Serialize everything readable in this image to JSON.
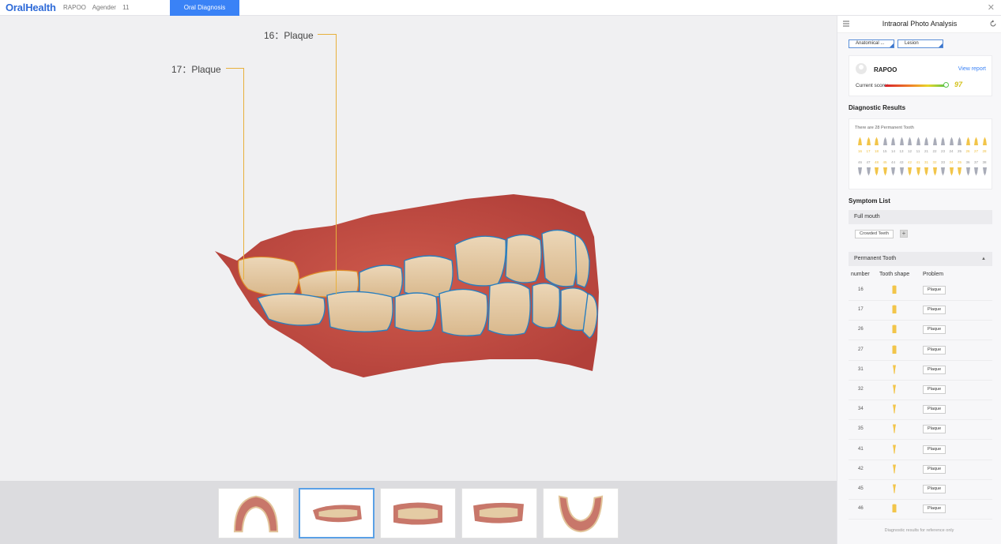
{
  "app": {
    "logo": "OralHealth",
    "patient_name": "RAPOO",
    "gender": "Agender",
    "age": "11",
    "active_tab": "Oral Diagnosis",
    "close_icon": "close-icon"
  },
  "viewer": {
    "annotations": [
      {
        "tooth": "16",
        "label": "16：Plaque"
      },
      {
        "tooth": "17",
        "label": "17：Plaque"
      }
    ],
    "annotation_color": "#e7b03c",
    "outline_color": "#2a7fbf"
  },
  "thumbnails": [
    {
      "name": "upper-arch",
      "active": false
    },
    {
      "name": "right-side",
      "active": true
    },
    {
      "name": "front",
      "active": false
    },
    {
      "name": "left-side",
      "active": false
    },
    {
      "name": "lower-arch",
      "active": false
    }
  ],
  "panel": {
    "title": "Intraoral Photo Analysis",
    "filters": [
      "Anatomical ...",
      "Lesion"
    ],
    "user": {
      "name": "RAPOO",
      "view_report": "View report",
      "score_label": "Current score:",
      "score_value": "97"
    },
    "diagnostic_title": "Diagnostic Results",
    "diagnostic_caption": "There are 28 Permanent Tooth",
    "upper_numbers": [
      "16",
      "17",
      "18",
      "15",
      "14",
      "13",
      "12",
      "11",
      "21",
      "22",
      "23",
      "24",
      "25",
      "26",
      "27",
      "28"
    ],
    "lower_numbers": [
      "46",
      "47",
      "48",
      "45",
      "44",
      "43",
      "42",
      "41",
      "31",
      "32",
      "33",
      "34",
      "35",
      "36",
      "37",
      "38"
    ],
    "upper_highlight": [
      "16",
      "17",
      "18",
      "26",
      "27",
      "28"
    ],
    "lower_highlight": [
      "48",
      "45",
      "42",
      "41",
      "31",
      "32",
      "34",
      "35"
    ],
    "symptom_title": "Symptom List",
    "full_mouth_label": "Full mouth",
    "full_mouth_chip": "Crowded Teeth",
    "add_label": "+",
    "permanent_label": "Permanent Tooth",
    "table_headers": {
      "number": "number",
      "shape": "Tooth shape",
      "problem": "Problem"
    },
    "rows": [
      {
        "number": "16",
        "problem": "Plaque",
        "shape": "molar"
      },
      {
        "number": "17",
        "problem": "Plaque",
        "shape": "molar"
      },
      {
        "number": "26",
        "problem": "Plaque",
        "shape": "molar"
      },
      {
        "number": "27",
        "problem": "Plaque",
        "shape": "molar"
      },
      {
        "number": "31",
        "problem": "Plaque",
        "shape": "incisor"
      },
      {
        "number": "32",
        "problem": "Plaque",
        "shape": "incisor"
      },
      {
        "number": "34",
        "problem": "Plaque",
        "shape": "incisor"
      },
      {
        "number": "35",
        "problem": "Plaque",
        "shape": "incisor"
      },
      {
        "number": "41",
        "problem": "Plaque",
        "shape": "incisor"
      },
      {
        "number": "42",
        "problem": "Plaque",
        "shape": "incisor"
      },
      {
        "number": "45",
        "problem": "Plaque",
        "shape": "incisor"
      },
      {
        "number": "46",
        "problem": "Plaque",
        "shape": "molar"
      }
    ],
    "footer": "Diagnostic results for reference only"
  },
  "colors": {
    "brand": "#2f6bd8",
    "tab_active": "#3a82f6",
    "highlight_tooth": "#f2c54a",
    "normal_tooth": "#a9acb8"
  }
}
